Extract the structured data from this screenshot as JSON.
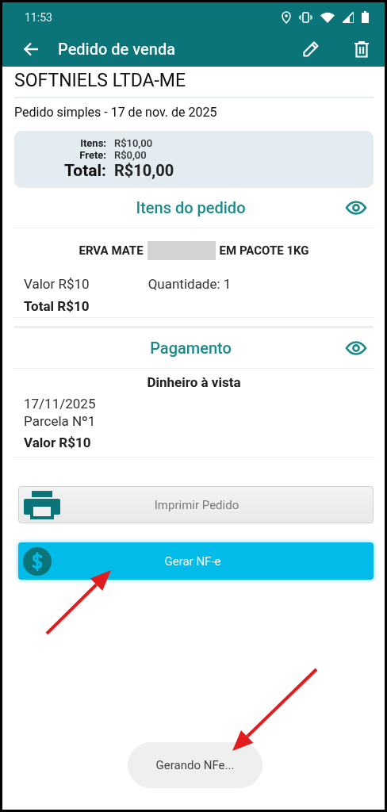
{
  "status_bar": {
    "time": "11:53"
  },
  "app_bar": {
    "title": "Pedido de venda"
  },
  "customer": "SOFTNIELS LTDA-ME",
  "order_subtitle": "Pedido simples - 17 de nov. de 2025",
  "summary": [
    {
      "label": "Itens:",
      "value": "R$10,00",
      "kind": "normal"
    },
    {
      "label": "Frete:",
      "value": "R$0,00",
      "kind": "normal"
    },
    {
      "label": "Total:",
      "value": "R$10,00",
      "kind": "total"
    }
  ],
  "items_section": {
    "title": "Itens do pedido",
    "items": [
      {
        "name_before": "ERVA MATE",
        "redacted": true,
        "name_after": "EM PACOTE 1KG",
        "value": "Valor R$10",
        "quantity": "Quantidade: 1",
        "total": "Total R$10"
      }
    ]
  },
  "payment_section": {
    "title": "Pagamento",
    "payments": [
      {
        "method": "Dinheiro à vista",
        "date": "17/11/2025",
        "installment": "Parcela Nº1",
        "value": "Valor R$10"
      }
    ]
  },
  "buttons": [
    {
      "label": "Imprimir Pedido",
      "kind": "print"
    },
    {
      "label": "Gerar NF-e",
      "kind": "nfe"
    }
  ],
  "toast": "Gerando NFe..."
}
